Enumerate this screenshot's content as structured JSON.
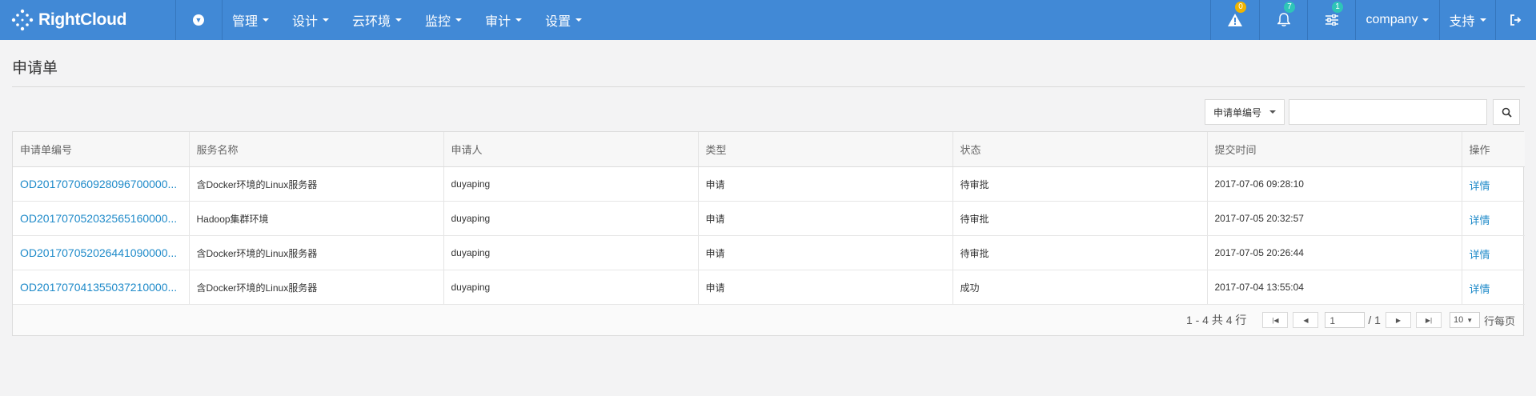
{
  "app": {
    "logo_text": "RightCloud"
  },
  "nav": {
    "items": [
      {
        "label": "管理"
      },
      {
        "label": "设计"
      },
      {
        "label": "云环境"
      },
      {
        "label": "监控"
      },
      {
        "label": "审计"
      },
      {
        "label": "设置"
      }
    ]
  },
  "topright": {
    "alerts_badge": "0",
    "notifications_badge": "7",
    "settings_badge": "1",
    "tenant": "company",
    "support": "支持",
    "colors": {
      "alert_badge": "#f0b400",
      "info_badge": "#2ec5b8"
    }
  },
  "page": {
    "title": "申请单"
  },
  "search": {
    "field_label": "申请单编号",
    "value": ""
  },
  "table": {
    "columns": [
      "申请单编号",
      "服务名称",
      "申请人",
      "类型",
      "状态",
      "提交时间",
      "操作"
    ],
    "rows": [
      {
        "id": "OD201707060928096700000...",
        "service": "含Docker环境的Linux服务器",
        "applicant": "duyaping",
        "type": "申请",
        "status": "待审批",
        "submitted": "2017-07-06 09:28:10",
        "action": "详情"
      },
      {
        "id": "OD201707052032565160000...",
        "service": "Hadoop集群环境",
        "applicant": "duyaping",
        "type": "申请",
        "status": "待审批",
        "submitted": "2017-07-05 20:32:57",
        "action": "详情"
      },
      {
        "id": "OD201707052026441090000...",
        "service": "含Docker环境的Linux服务器",
        "applicant": "duyaping",
        "type": "申请",
        "status": "待审批",
        "submitted": "2017-07-05 20:26:44",
        "action": "详情"
      },
      {
        "id": "OD201707041355037210000...",
        "service": "含Docker环境的Linux服务器",
        "applicant": "duyaping",
        "type": "申请",
        "status": "成功",
        "submitted": "2017-07-04 13:55:04",
        "action": "详情"
      }
    ]
  },
  "pager": {
    "summary": "1 - 4 共 4 行",
    "page": "1",
    "total_pages": "/ 1",
    "page_size": "10",
    "page_size_suffix": "行每页"
  }
}
